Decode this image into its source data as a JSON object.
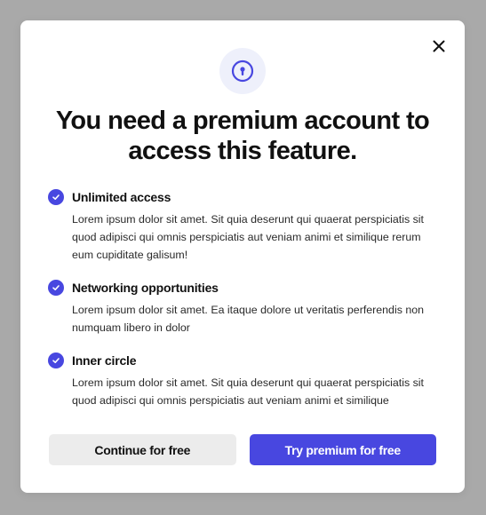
{
  "modal": {
    "title": "You need a premium account to access this feature.",
    "close_icon": "close-icon",
    "lock_icon": "keyhole-lock-icon",
    "accent_color": "#4847e0",
    "features": [
      {
        "title": "Unlimited access",
        "description": "Lorem ipsum dolor sit amet. Sit quia deserunt qui quaerat perspiciatis sit quod adipisci qui omnis perspiciatis aut veniam animi et similique rerum eum cupiditate galisum!"
      },
      {
        "title": "Networking opportunities",
        "description": "Lorem ipsum dolor sit amet. Ea itaque dolore ut veritatis perferendis non numquam libero in dolor"
      },
      {
        "title": "Inner circle",
        "description": "Lorem ipsum dolor sit amet. Sit quia deserunt qui quaerat perspiciatis sit quod adipisci qui omnis perspiciatis aut veniam animi et similique"
      }
    ],
    "actions": {
      "continue_label": "Continue for free",
      "premium_label": "Try premium for free"
    }
  }
}
